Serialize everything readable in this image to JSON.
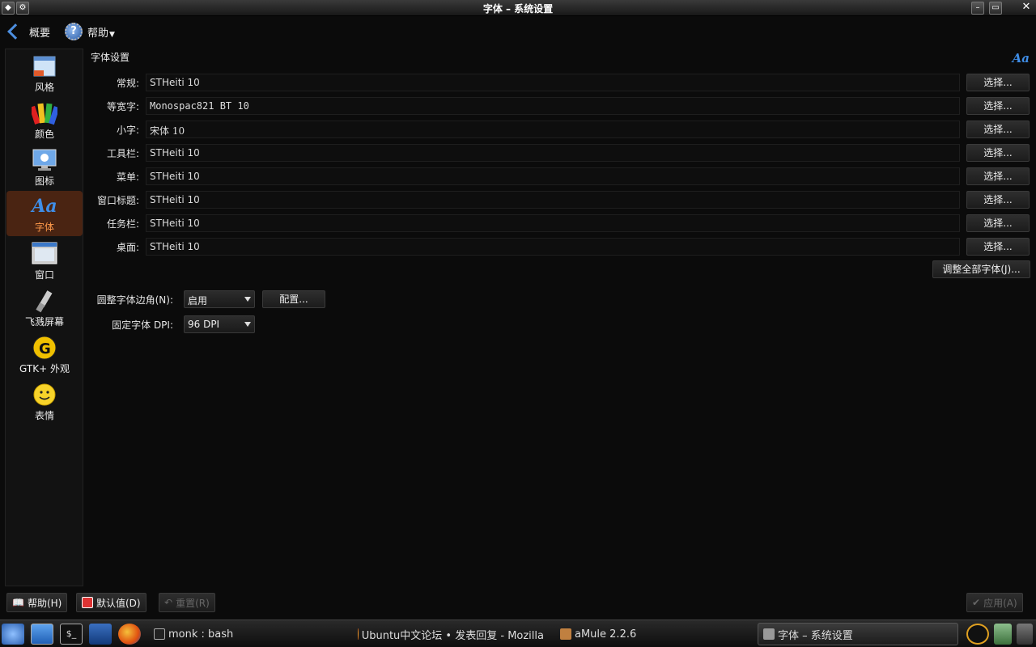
{
  "window": {
    "title": "字体 – 系统设置",
    "buttons": {
      "minimize": "–",
      "maximize": "▭",
      "close": "✕"
    }
  },
  "toolbar": {
    "overview_label": "概要",
    "help_label": "帮助"
  },
  "sidebar": {
    "items": [
      {
        "label": "风格",
        "icon": "style-icon"
      },
      {
        "label": "颜色",
        "icon": "color-palette-icon"
      },
      {
        "label": "图标",
        "icon": "icons-icon"
      },
      {
        "label": "字体",
        "icon": "font-icon",
        "active": true
      },
      {
        "label": "窗口",
        "icon": "window-icon"
      },
      {
        "label": "飞溅屏幕",
        "icon": "splash-screen-icon"
      },
      {
        "label": "GTK+ 外观",
        "icon": "gtk-icon"
      },
      {
        "label": "表情",
        "icon": "emoticon-icon"
      }
    ]
  },
  "main": {
    "section_title": "字体设置",
    "aa_icon": "Aa",
    "choose_label": "选择...",
    "fonts": [
      {
        "label": "常规:",
        "value": "STHeiti 10"
      },
      {
        "label": "等宽字:",
        "value": "Monospac821 BT 10"
      },
      {
        "label": "小字:",
        "value": "宋体 10"
      },
      {
        "label": "工具栏:",
        "value": "STHeiti 10"
      },
      {
        "label": "菜单:",
        "value": "STHeiti 10"
      },
      {
        "label": "窗口标题:",
        "value": "STHeiti 10"
      },
      {
        "label": "任务栏:",
        "value": "STHeiti 10"
      },
      {
        "label": "桌面:",
        "value": "STHeiti 10"
      }
    ],
    "adjust_all_label": "调整全部字体(J)...",
    "antialias": {
      "label": "圆整字体边角(N):",
      "value": "启用",
      "config_label": "配置..."
    },
    "dpi": {
      "label": "固定字体 DPI:",
      "value": "96 DPI"
    }
  },
  "bottom": {
    "help_label": "帮助(H)",
    "defaults_label": "默认值(D)",
    "reset_label": "重置(R)",
    "apply_label": "应用(A)"
  },
  "taskbar": {
    "tasks": [
      {
        "label": "monk : bash"
      },
      {
        "label": "Ubuntu中文论坛 • 发表回复 - Mozilla"
      },
      {
        "label": "aMule 2.2.6"
      },
      {
        "label": "字体 – 系统设置"
      }
    ]
  },
  "colors": {
    "accent": "#3f8ee8",
    "active_bg": "#4a2412",
    "active_text": "#ff9a4a"
  }
}
